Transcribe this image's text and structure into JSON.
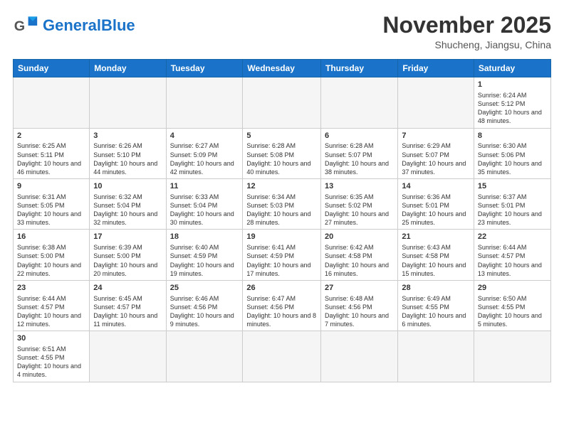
{
  "header": {
    "logo_general": "General",
    "logo_blue": "Blue",
    "month_title": "November 2025",
    "subtitle": "Shucheng, Jiangsu, China"
  },
  "weekdays": [
    "Sunday",
    "Monday",
    "Tuesday",
    "Wednesday",
    "Thursday",
    "Friday",
    "Saturday"
  ],
  "weeks": [
    [
      {
        "day": "",
        "info": ""
      },
      {
        "day": "",
        "info": ""
      },
      {
        "day": "",
        "info": ""
      },
      {
        "day": "",
        "info": ""
      },
      {
        "day": "",
        "info": ""
      },
      {
        "day": "",
        "info": ""
      },
      {
        "day": "1",
        "info": "Sunrise: 6:24 AM\nSunset: 5:12 PM\nDaylight: 10 hours and 48 minutes."
      }
    ],
    [
      {
        "day": "2",
        "info": "Sunrise: 6:25 AM\nSunset: 5:11 PM\nDaylight: 10 hours and 46 minutes."
      },
      {
        "day": "3",
        "info": "Sunrise: 6:26 AM\nSunset: 5:10 PM\nDaylight: 10 hours and 44 minutes."
      },
      {
        "day": "4",
        "info": "Sunrise: 6:27 AM\nSunset: 5:09 PM\nDaylight: 10 hours and 42 minutes."
      },
      {
        "day": "5",
        "info": "Sunrise: 6:28 AM\nSunset: 5:08 PM\nDaylight: 10 hours and 40 minutes."
      },
      {
        "day": "6",
        "info": "Sunrise: 6:28 AM\nSunset: 5:07 PM\nDaylight: 10 hours and 38 minutes."
      },
      {
        "day": "7",
        "info": "Sunrise: 6:29 AM\nSunset: 5:07 PM\nDaylight: 10 hours and 37 minutes."
      },
      {
        "day": "8",
        "info": "Sunrise: 6:30 AM\nSunset: 5:06 PM\nDaylight: 10 hours and 35 minutes."
      }
    ],
    [
      {
        "day": "9",
        "info": "Sunrise: 6:31 AM\nSunset: 5:05 PM\nDaylight: 10 hours and 33 minutes."
      },
      {
        "day": "10",
        "info": "Sunrise: 6:32 AM\nSunset: 5:04 PM\nDaylight: 10 hours and 32 minutes."
      },
      {
        "day": "11",
        "info": "Sunrise: 6:33 AM\nSunset: 5:04 PM\nDaylight: 10 hours and 30 minutes."
      },
      {
        "day": "12",
        "info": "Sunrise: 6:34 AM\nSunset: 5:03 PM\nDaylight: 10 hours and 28 minutes."
      },
      {
        "day": "13",
        "info": "Sunrise: 6:35 AM\nSunset: 5:02 PM\nDaylight: 10 hours and 27 minutes."
      },
      {
        "day": "14",
        "info": "Sunrise: 6:36 AM\nSunset: 5:01 PM\nDaylight: 10 hours and 25 minutes."
      },
      {
        "day": "15",
        "info": "Sunrise: 6:37 AM\nSunset: 5:01 PM\nDaylight: 10 hours and 23 minutes."
      }
    ],
    [
      {
        "day": "16",
        "info": "Sunrise: 6:38 AM\nSunset: 5:00 PM\nDaylight: 10 hours and 22 minutes."
      },
      {
        "day": "17",
        "info": "Sunrise: 6:39 AM\nSunset: 5:00 PM\nDaylight: 10 hours and 20 minutes."
      },
      {
        "day": "18",
        "info": "Sunrise: 6:40 AM\nSunset: 4:59 PM\nDaylight: 10 hours and 19 minutes."
      },
      {
        "day": "19",
        "info": "Sunrise: 6:41 AM\nSunset: 4:59 PM\nDaylight: 10 hours and 17 minutes."
      },
      {
        "day": "20",
        "info": "Sunrise: 6:42 AM\nSunset: 4:58 PM\nDaylight: 10 hours and 16 minutes."
      },
      {
        "day": "21",
        "info": "Sunrise: 6:43 AM\nSunset: 4:58 PM\nDaylight: 10 hours and 15 minutes."
      },
      {
        "day": "22",
        "info": "Sunrise: 6:44 AM\nSunset: 4:57 PM\nDaylight: 10 hours and 13 minutes."
      }
    ],
    [
      {
        "day": "23",
        "info": "Sunrise: 6:44 AM\nSunset: 4:57 PM\nDaylight: 10 hours and 12 minutes."
      },
      {
        "day": "24",
        "info": "Sunrise: 6:45 AM\nSunset: 4:57 PM\nDaylight: 10 hours and 11 minutes."
      },
      {
        "day": "25",
        "info": "Sunrise: 6:46 AM\nSunset: 4:56 PM\nDaylight: 10 hours and 9 minutes."
      },
      {
        "day": "26",
        "info": "Sunrise: 6:47 AM\nSunset: 4:56 PM\nDaylight: 10 hours and 8 minutes."
      },
      {
        "day": "27",
        "info": "Sunrise: 6:48 AM\nSunset: 4:56 PM\nDaylight: 10 hours and 7 minutes."
      },
      {
        "day": "28",
        "info": "Sunrise: 6:49 AM\nSunset: 4:55 PM\nDaylight: 10 hours and 6 minutes."
      },
      {
        "day": "29",
        "info": "Sunrise: 6:50 AM\nSunset: 4:55 PM\nDaylight: 10 hours and 5 minutes."
      }
    ],
    [
      {
        "day": "30",
        "info": "Sunrise: 6:51 AM\nSunset: 4:55 PM\nDaylight: 10 hours and 4 minutes."
      },
      {
        "day": "",
        "info": ""
      },
      {
        "day": "",
        "info": ""
      },
      {
        "day": "",
        "info": ""
      },
      {
        "day": "",
        "info": ""
      },
      {
        "day": "",
        "info": ""
      },
      {
        "day": "",
        "info": ""
      }
    ]
  ]
}
